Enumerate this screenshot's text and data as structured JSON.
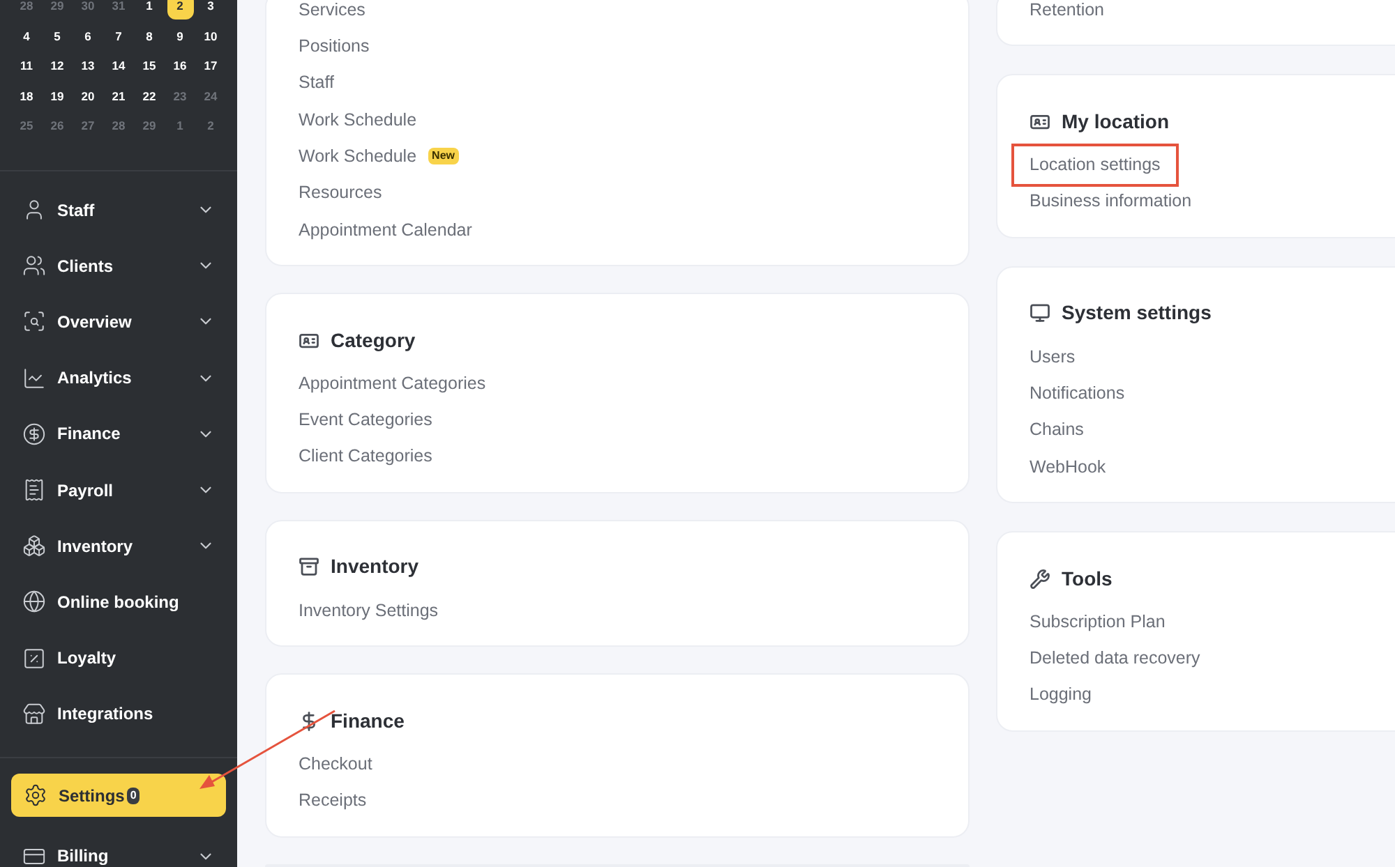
{
  "calendar": {
    "weeks": [
      [
        {
          "day": "28",
          "muted": true,
          "selected": false
        },
        {
          "day": "29",
          "muted": true,
          "selected": false
        },
        {
          "day": "30",
          "muted": true,
          "selected": false
        },
        {
          "day": "31",
          "muted": true,
          "selected": false
        },
        {
          "day": "1",
          "muted": false,
          "selected": false
        },
        {
          "day": "2",
          "muted": false,
          "selected": true
        },
        {
          "day": "3",
          "muted": false,
          "selected": false
        }
      ],
      [
        {
          "day": "4",
          "muted": false,
          "selected": false
        },
        {
          "day": "5",
          "muted": false,
          "selected": false
        },
        {
          "day": "6",
          "muted": false,
          "selected": false
        },
        {
          "day": "7",
          "muted": false,
          "selected": false
        },
        {
          "day": "8",
          "muted": false,
          "selected": false
        },
        {
          "day": "9",
          "muted": false,
          "selected": false
        },
        {
          "day": "10",
          "muted": false,
          "selected": false
        }
      ],
      [
        {
          "day": "11",
          "muted": false,
          "selected": false
        },
        {
          "day": "12",
          "muted": false,
          "selected": false
        },
        {
          "day": "13",
          "muted": false,
          "selected": false
        },
        {
          "day": "14",
          "muted": false,
          "selected": false
        },
        {
          "day": "15",
          "muted": false,
          "selected": false
        },
        {
          "day": "16",
          "muted": false,
          "selected": false
        },
        {
          "day": "17",
          "muted": false,
          "selected": false
        }
      ],
      [
        {
          "day": "18",
          "muted": false,
          "selected": false
        },
        {
          "day": "19",
          "muted": false,
          "selected": false
        },
        {
          "day": "20",
          "muted": false,
          "selected": false
        },
        {
          "day": "21",
          "muted": false,
          "selected": false
        },
        {
          "day": "22",
          "muted": false,
          "selected": false
        },
        {
          "day": "23",
          "muted": true,
          "selected": false
        },
        {
          "day": "24",
          "muted": true,
          "selected": false
        }
      ],
      [
        {
          "day": "25",
          "muted": true,
          "selected": false
        },
        {
          "day": "26",
          "muted": true,
          "selected": false
        },
        {
          "day": "27",
          "muted": true,
          "selected": false
        },
        {
          "day": "28",
          "muted": true,
          "selected": false
        },
        {
          "day": "29",
          "muted": true,
          "selected": false
        },
        {
          "day": "1",
          "muted": true,
          "selected": false
        },
        {
          "day": "2",
          "muted": true,
          "selected": false
        }
      ]
    ]
  },
  "nav": [
    {
      "label": "Staff",
      "expandable": true,
      "selected": false
    },
    {
      "label": "Clients",
      "expandable": true,
      "selected": false
    },
    {
      "label": "Overview",
      "expandable": true,
      "selected": false
    },
    {
      "label": "Analytics",
      "expandable": true,
      "selected": false
    },
    {
      "label": "Finance",
      "expandable": true,
      "selected": false
    },
    {
      "label": "Payroll",
      "expandable": true,
      "selected": false
    },
    {
      "label": "Inventory",
      "expandable": true,
      "selected": false
    },
    {
      "label": "Online booking",
      "expandable": false,
      "selected": false
    },
    {
      "label": "Loyalty",
      "expandable": false,
      "selected": false
    },
    {
      "label": "Integrations",
      "expandable": false,
      "selected": false
    },
    {
      "label": "Settings",
      "expandable": false,
      "selected": true,
      "badge": "0"
    },
    {
      "label": "Billing",
      "expandable": true,
      "selected": false
    }
  ],
  "left_cards": [
    {
      "items": [
        {
          "label": "Services",
          "highlighted": false
        },
        {
          "label": "Positions",
          "highlighted": false
        },
        {
          "label": "Staff",
          "highlighted": false
        },
        {
          "label": "Work Schedule",
          "highlighted": false
        },
        {
          "label": "Work Schedule",
          "badge": "New",
          "highlighted": false
        },
        {
          "label": "Resources",
          "highlighted": false
        },
        {
          "label": "Appointment Calendar",
          "highlighted": false
        }
      ]
    },
    {
      "title": "Category",
      "items": [
        {
          "label": "Appointment Categories",
          "highlighted": false
        },
        {
          "label": "Event Categories",
          "highlighted": false
        },
        {
          "label": "Client Categories",
          "highlighted": false
        }
      ]
    },
    {
      "title": "Inventory",
      "items": [
        {
          "label": "Inventory Settings",
          "highlighted": false
        }
      ]
    },
    {
      "title": "Finance",
      "items": [
        {
          "label": "Checkout",
          "highlighted": false
        },
        {
          "label": "Receipts",
          "highlighted": false
        }
      ]
    }
  ],
  "right_cards": [
    {
      "items": [
        {
          "label": "Retention",
          "highlighted": false
        }
      ]
    },
    {
      "title": "My location",
      "items": [
        {
          "label": "Location settings",
          "highlighted": true
        },
        {
          "label": "Business information",
          "highlighted": false
        }
      ]
    },
    {
      "title": "System settings",
      "items": [
        {
          "label": "Users",
          "highlighted": false
        },
        {
          "label": "Notifications",
          "highlighted": false
        },
        {
          "label": "Chains",
          "highlighted": false
        },
        {
          "label": "WebHook",
          "highlighted": false
        }
      ]
    },
    {
      "title": "Tools",
      "items": [
        {
          "label": "Subscription Plan",
          "highlighted": false
        },
        {
          "label": "Deleted data recovery",
          "highlighted": false
        },
        {
          "label": "Logging",
          "highlighted": false
        }
      ]
    }
  ]
}
